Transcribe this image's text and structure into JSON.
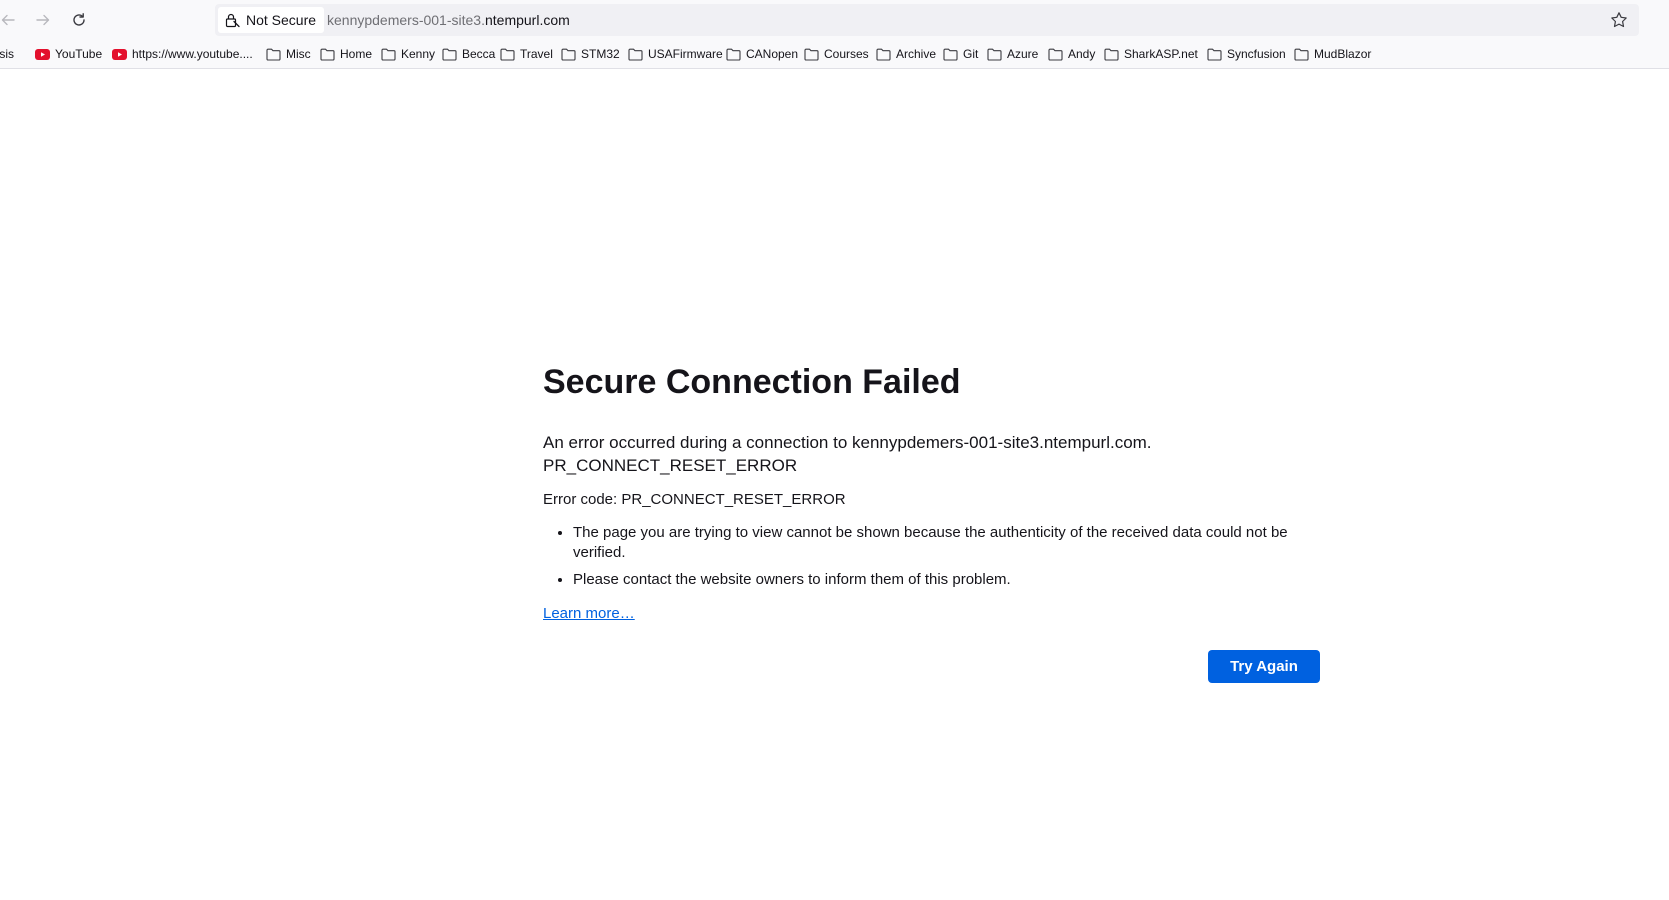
{
  "toolbar": {
    "back_label": "Back",
    "forward_label": "Forward",
    "reload_label": "Reload"
  },
  "urlbar": {
    "security_label": "Not Secure",
    "url_prefix": "kennypdemers-001-site3.",
    "url_domain": "ntempurl.com"
  },
  "bookmarks": [
    {
      "label": "nasis",
      "icon": "none"
    },
    {
      "label": "YouTube",
      "icon": "youtube-icon"
    },
    {
      "label": "https://www.youtube....",
      "icon": "youtube-icon"
    },
    {
      "label": "Misc",
      "icon": "folder-icon"
    },
    {
      "label": "Home",
      "icon": "folder-icon"
    },
    {
      "label": "Kenny",
      "icon": "folder-icon"
    },
    {
      "label": "Becca",
      "icon": "folder-icon"
    },
    {
      "label": "Travel",
      "icon": "folder-icon"
    },
    {
      "label": "STM32",
      "icon": "folder-icon"
    },
    {
      "label": "USAFirmware",
      "icon": "folder-icon"
    },
    {
      "label": "CANopen",
      "icon": "folder-icon"
    },
    {
      "label": "Courses",
      "icon": "folder-icon"
    },
    {
      "label": "Archive",
      "icon": "folder-icon"
    },
    {
      "label": "Git",
      "icon": "folder-icon"
    },
    {
      "label": "Azure",
      "icon": "folder-icon"
    },
    {
      "label": "Andy",
      "icon": "folder-icon"
    },
    {
      "label": "SharkASP.net",
      "icon": "folder-icon"
    },
    {
      "label": "Syncfusion",
      "icon": "folder-icon"
    },
    {
      "label": "MudBlazor",
      "icon": "folder-icon"
    }
  ],
  "error": {
    "title": "Secure Connection Failed",
    "desc_line1": "An error occurred during a connection to kennypdemers-001-site3.ntempurl.com.",
    "desc_line2": "PR_CONNECT_RESET_ERROR",
    "code_text": "Error code: PR_CONNECT_RESET_ERROR",
    "bullets": [
      "The page you are trying to view cannot be shown because the authenticity of the received data could not be verified.",
      "Please contact the website owners to inform them of this problem."
    ],
    "learn_more": "Learn more…",
    "try_again": "Try Again"
  },
  "colors": {
    "accent": "#0061e0",
    "youtube_red": "#e3102d",
    "toolbar_bg": "#f9f9fb",
    "urlbar_bg": "#f0f0f4"
  }
}
